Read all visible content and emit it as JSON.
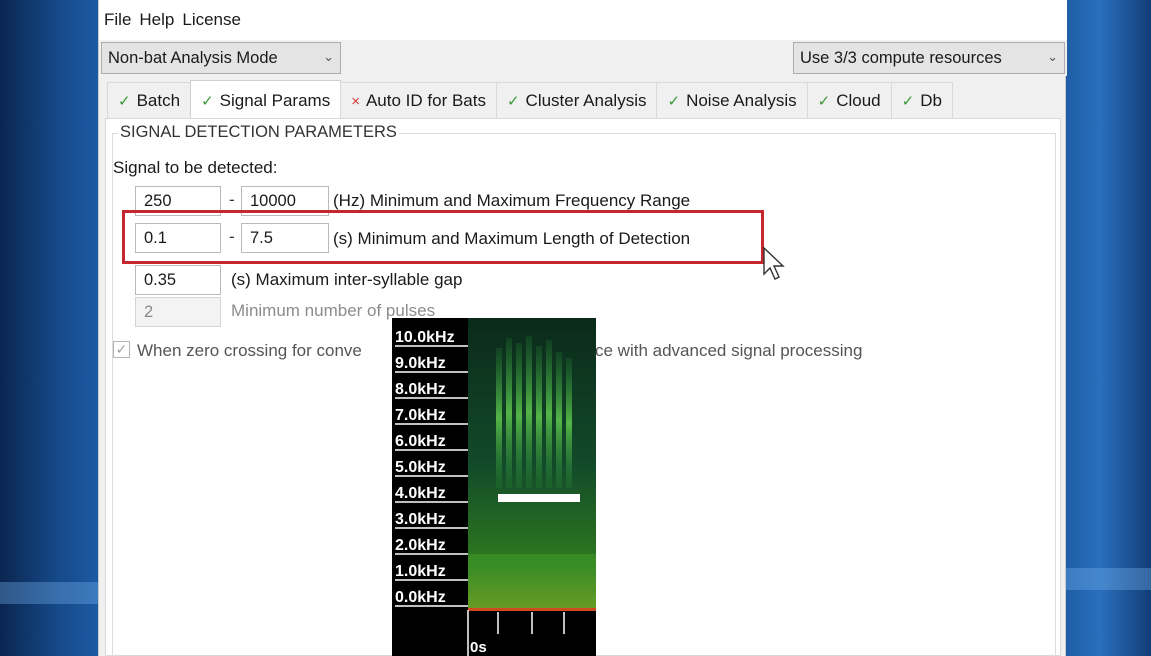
{
  "menu": [
    "File",
    "Help",
    "License"
  ],
  "mode_select": {
    "value": "Non-bat Analysis Mode"
  },
  "compute_select": {
    "value": "Use 3/3 compute resources"
  },
  "tabs": [
    {
      "label": "Batch",
      "status": "ok"
    },
    {
      "label": "Signal Params",
      "status": "ok",
      "active": true
    },
    {
      "label": "Auto ID for Bats",
      "status": "bad"
    },
    {
      "label": "Cluster Analysis",
      "status": "ok"
    },
    {
      "label": "Noise Analysis",
      "status": "ok"
    },
    {
      "label": "Cloud",
      "status": "ok"
    },
    {
      "label": "Db",
      "status": "ok"
    }
  ],
  "status_marks": {
    "ok": "✓",
    "bad": "×"
  },
  "group_title": "SIGNAL DETECTION PARAMETERS",
  "signal_label": "Signal to be detected:",
  "freq": {
    "min": "250",
    "max": "10000",
    "desc": "(Hz) Minimum and Maximum Frequency Range"
  },
  "length": {
    "min": "0.1",
    "max": "7.5",
    "desc": "(s) Minimum and Maximum Length of Detection"
  },
  "gap": {
    "value": "0.35",
    "desc": "(s) Maximum inter-syllable gap"
  },
  "pulses": {
    "value": "2",
    "desc": "Minimum number of pulses"
  },
  "dash": "-",
  "zero_crossing": {
    "left": "When zero crossing for conve",
    "right": "ce with advanced signal processing",
    "checked": true
  },
  "spectrogram": {
    "freq_labels": [
      "10.0kHz",
      "9.0kHz",
      "8.0kHz",
      "7.0kHz",
      "6.0kHz",
      "5.0kHz",
      "4.0kHz",
      "3.0kHz",
      "2.0kHz",
      "1.0kHz",
      "0.0kHz"
    ],
    "time_label": "0s"
  },
  "colors": {
    "highlight": "#c8262e",
    "ok": "#3a9b3a",
    "bad": "#d83a3a"
  }
}
